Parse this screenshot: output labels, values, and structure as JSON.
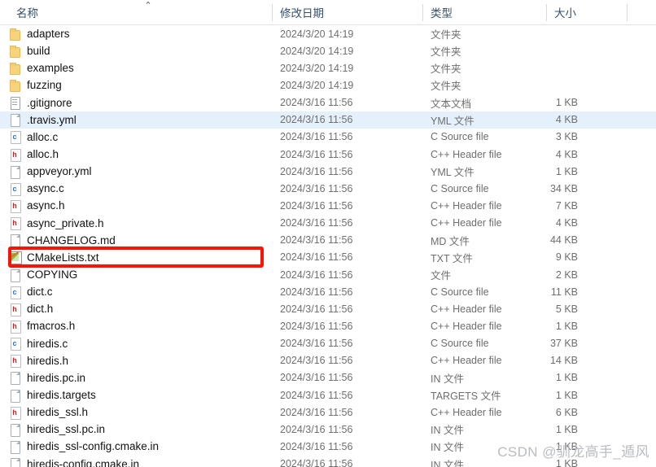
{
  "header": {
    "sort_indicator": "⌃",
    "columns": [
      {
        "key": "name",
        "label": "名称"
      },
      {
        "key": "date",
        "label": "修改日期"
      },
      {
        "key": "type",
        "label": "类型"
      },
      {
        "key": "size",
        "label": "大小"
      }
    ]
  },
  "files": [
    {
      "name": "adapters",
      "date": "2024/3/20 14:19",
      "type": "文件夹",
      "size": "",
      "icon": "folder-icon",
      "selected": false
    },
    {
      "name": "build",
      "date": "2024/3/20 14:19",
      "type": "文件夹",
      "size": "",
      "icon": "folder-icon",
      "selected": false
    },
    {
      "name": "examples",
      "date": "2024/3/20 14:19",
      "type": "文件夹",
      "size": "",
      "icon": "folder-icon",
      "selected": false
    },
    {
      "name": "fuzzing",
      "date": "2024/3/20 14:19",
      "type": "文件夹",
      "size": "",
      "icon": "folder-icon",
      "selected": false
    },
    {
      "name": ".gitignore",
      "date": "2024/3/16 11:56",
      "type": "文本文档",
      "size": "1 KB",
      "icon": "text-document-icon",
      "selected": false
    },
    {
      "name": ".travis.yml",
      "date": "2024/3/16 11:56",
      "type": "YML 文件",
      "size": "4 KB",
      "icon": "blank-page-icon",
      "selected": true
    },
    {
      "name": "alloc.c",
      "date": "2024/3/16 11:56",
      "type": "C Source file",
      "size": "3 KB",
      "icon": "c-source-icon",
      "selected": false
    },
    {
      "name": "alloc.h",
      "date": "2024/3/16 11:56",
      "type": "C++ Header file",
      "size": "4 KB",
      "icon": "h-header-icon",
      "selected": false
    },
    {
      "name": "appveyor.yml",
      "date": "2024/3/16 11:56",
      "type": "YML 文件",
      "size": "1 KB",
      "icon": "blank-page-icon",
      "selected": false
    },
    {
      "name": "async.c",
      "date": "2024/3/16 11:56",
      "type": "C Source file",
      "size": "34 KB",
      "icon": "c-source-icon",
      "selected": false
    },
    {
      "name": "async.h",
      "date": "2024/3/16 11:56",
      "type": "C++ Header file",
      "size": "7 KB",
      "icon": "h-header-icon",
      "selected": false
    },
    {
      "name": "async_private.h",
      "date": "2024/3/16 11:56",
      "type": "C++ Header file",
      "size": "4 KB",
      "icon": "h-header-icon",
      "selected": false
    },
    {
      "name": "CHANGELOG.md",
      "date": "2024/3/16 11:56",
      "type": "MD 文件",
      "size": "44 KB",
      "icon": "blank-page-icon",
      "selected": false
    },
    {
      "name": "CMakeLists.txt",
      "date": "2024/3/16 11:56",
      "type": "TXT 文件",
      "size": "9 KB",
      "icon": "cmake-icon",
      "selected": false
    },
    {
      "name": "COPYING",
      "date": "2024/3/16 11:56",
      "type": "文件",
      "size": "2 KB",
      "icon": "blank-page-icon",
      "selected": false
    },
    {
      "name": "dict.c",
      "date": "2024/3/16 11:56",
      "type": "C Source file",
      "size": "11 KB",
      "icon": "c-source-icon",
      "selected": false
    },
    {
      "name": "dict.h",
      "date": "2024/3/16 11:56",
      "type": "C++ Header file",
      "size": "5 KB",
      "icon": "h-header-icon",
      "selected": false
    },
    {
      "name": "fmacros.h",
      "date": "2024/3/16 11:56",
      "type": "C++ Header file",
      "size": "1 KB",
      "icon": "h-header-icon",
      "selected": false
    },
    {
      "name": "hiredis.c",
      "date": "2024/3/16 11:56",
      "type": "C Source file",
      "size": "37 KB",
      "icon": "c-source-icon",
      "selected": false
    },
    {
      "name": "hiredis.h",
      "date": "2024/3/16 11:56",
      "type": "C++ Header file",
      "size": "14 KB",
      "icon": "h-header-icon",
      "selected": false
    },
    {
      "name": "hiredis.pc.in",
      "date": "2024/3/16 11:56",
      "type": "IN 文件",
      "size": "1 KB",
      "icon": "blank-page-icon",
      "selected": false
    },
    {
      "name": "hiredis.targets",
      "date": "2024/3/16 11:56",
      "type": "TARGETS 文件",
      "size": "1 KB",
      "icon": "blank-page-icon",
      "selected": false
    },
    {
      "name": "hiredis_ssl.h",
      "date": "2024/3/16 11:56",
      "type": "C++ Header file",
      "size": "6 KB",
      "icon": "h-header-icon",
      "selected": false
    },
    {
      "name": "hiredis_ssl.pc.in",
      "date": "2024/3/16 11:56",
      "type": "IN 文件",
      "size": "1 KB",
      "icon": "blank-page-icon",
      "selected": false
    },
    {
      "name": "hiredis_ssl-config.cmake.in",
      "date": "2024/3/16 11:56",
      "type": "IN 文件",
      "size": "1 KB",
      "icon": "blank-page-icon",
      "selected": false
    },
    {
      "name": "hiredis-config.cmake.in",
      "date": "2024/3/16 11:56",
      "type": "IN 文件",
      "size": "1 KB",
      "icon": "blank-page-icon",
      "selected": false
    }
  ],
  "annotation": {
    "target_row_index": 13,
    "color": "#fa1405"
  },
  "watermark": {
    "text": "CSDN @驯龙高手_遁风"
  }
}
